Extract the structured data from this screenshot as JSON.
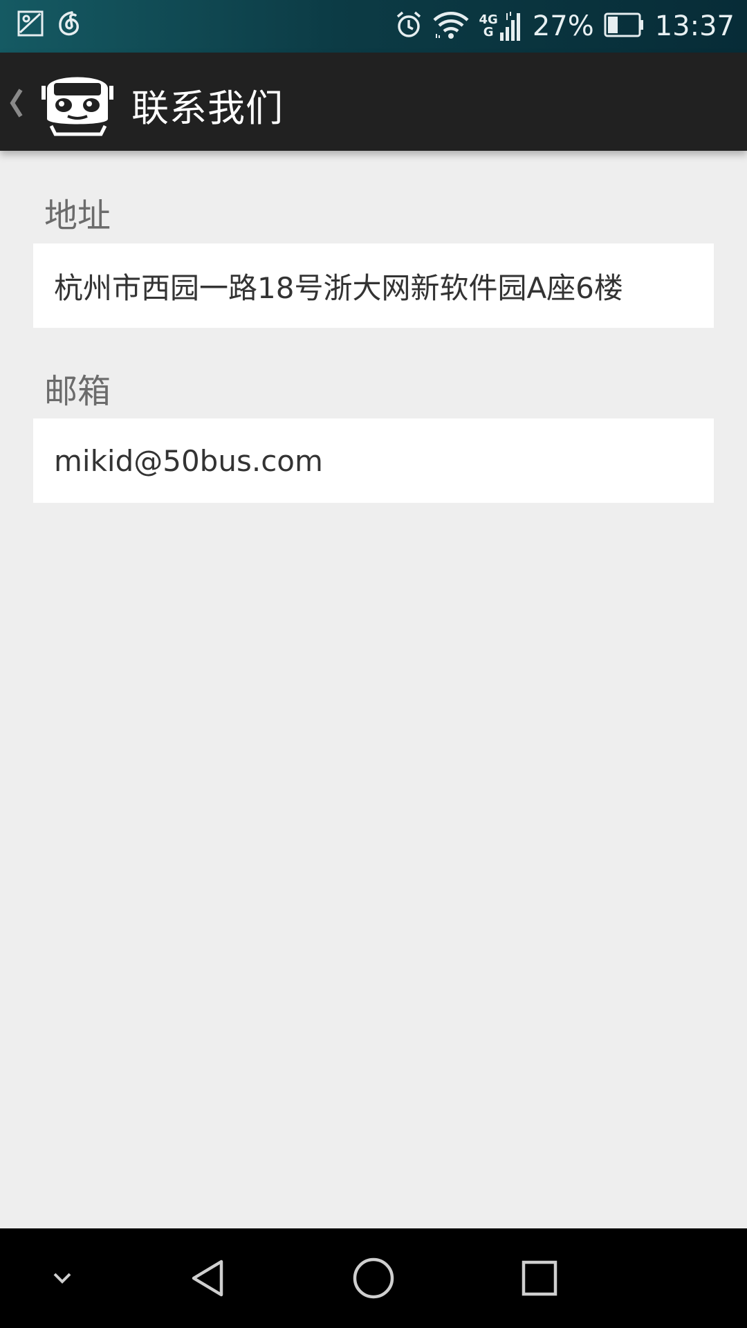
{
  "status_bar": {
    "battery_percent": "27%",
    "time": "13:37",
    "network_type": "4G",
    "network_sub": "G",
    "icons": [
      "gallery-icon",
      "netease-music-icon",
      "alarm-icon",
      "wifi-icon",
      "signal-icon",
      "battery-icon"
    ]
  },
  "action_bar": {
    "title": "联系我们",
    "icons": [
      "back-chevron-icon",
      "bus-logo-icon"
    ]
  },
  "contact": {
    "address_label": "地址",
    "address_value": "杭州市西园一路18号浙大网新软件园A座6楼",
    "email_label": "邮箱",
    "email_value": "mikid@50bus.com"
  },
  "nav_bar": {
    "icons": [
      "hide-nav-chevron-icon",
      "back-triangle-icon",
      "home-circle-icon",
      "recents-square-icon"
    ]
  },
  "colors": {
    "status_bar_start": "#155a63",
    "status_bar_end": "#072c37",
    "action_bar": "#212121",
    "background": "#eeeeee",
    "field": "#ffffff",
    "label_text": "#6b6b6b",
    "value_text": "#333333"
  }
}
